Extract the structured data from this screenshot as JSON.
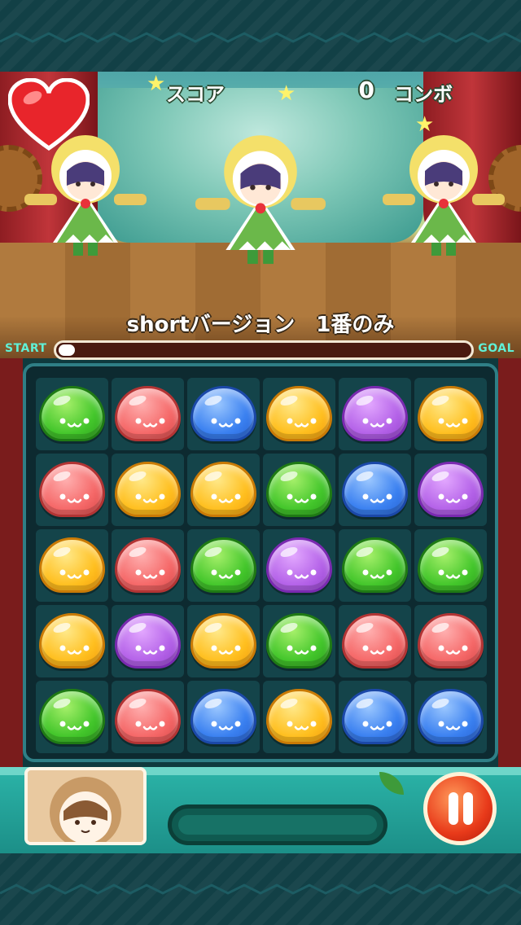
{
  "hud": {
    "score_label": "スコア",
    "score_value": "0",
    "combo_label": "コンボ"
  },
  "song": {
    "title": "shortバージョン　1番のみ"
  },
  "progress": {
    "start_label": "START",
    "goal_label": "GOAL",
    "fraction": 0.04
  },
  "board": {
    "rows": [
      [
        "green",
        "red",
        "blue",
        "yellow",
        "purple",
        "yellow"
      ],
      [
        "red",
        "yellow",
        "yellow",
        "green",
        "blue",
        "purple"
      ],
      [
        "yellow",
        "red",
        "green",
        "purple",
        "green",
        "green"
      ],
      [
        "yellow",
        "purple",
        "yellow",
        "green",
        "red",
        "red"
      ],
      [
        "green",
        "red",
        "blue",
        "yellow",
        "blue",
        "blue"
      ]
    ]
  },
  "icons": {
    "life": "heart-icon",
    "pause": "pause-icon"
  },
  "colors": {
    "accent": "#2bb4a8",
    "start_goal": "#5ff0d6"
  }
}
